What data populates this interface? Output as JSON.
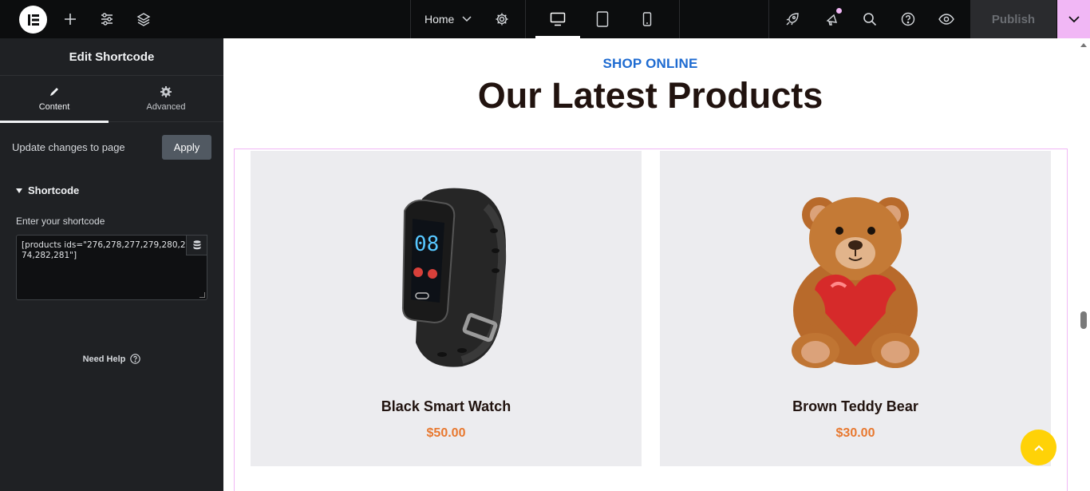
{
  "topbar": {
    "page_name": "Home",
    "publish_label": "Publish",
    "colors": {
      "bg": "#0c0d0e",
      "accent": "#f1b7f5",
      "publish_bg": "#2a2b2e"
    },
    "icons": [
      "elementor-logo-icon",
      "add-icon",
      "sliders-icon",
      "layers-icon",
      "chevron-down-icon",
      "gear-icon",
      "desktop-icon",
      "tablet-icon",
      "mobile-icon",
      "rocket-icon",
      "whats-new-icon",
      "search-icon",
      "help-icon",
      "eye-icon",
      "chevron-down-icon"
    ]
  },
  "sidebar": {
    "title": "Edit Shortcode",
    "tabs": [
      {
        "label": "Content",
        "icon": "pencil-icon",
        "active": true
      },
      {
        "label": "Advanced",
        "icon": "gear-icon",
        "active": false
      }
    ],
    "update_text": "Update changes to page",
    "apply_label": "Apply",
    "section_title": "Shortcode",
    "field_label": "Enter your shortcode",
    "shortcode_value": "[products ids=\"276,278,277,279,280,274,282,281\"]",
    "need_help": "Need Help"
  },
  "canvas": {
    "kicker": "SHOP ONLINE",
    "heading": "Our Latest Products",
    "products": [
      {
        "name": "Black Smart Watch",
        "price": "$50.00"
      },
      {
        "name": "Brown Teddy Bear",
        "price": "$30.00"
      }
    ],
    "colors": {
      "kicker": "#1e6bd1",
      "price": "#e8782f",
      "card_bg": "#ececef",
      "to_top": "#ffd207"
    }
  }
}
